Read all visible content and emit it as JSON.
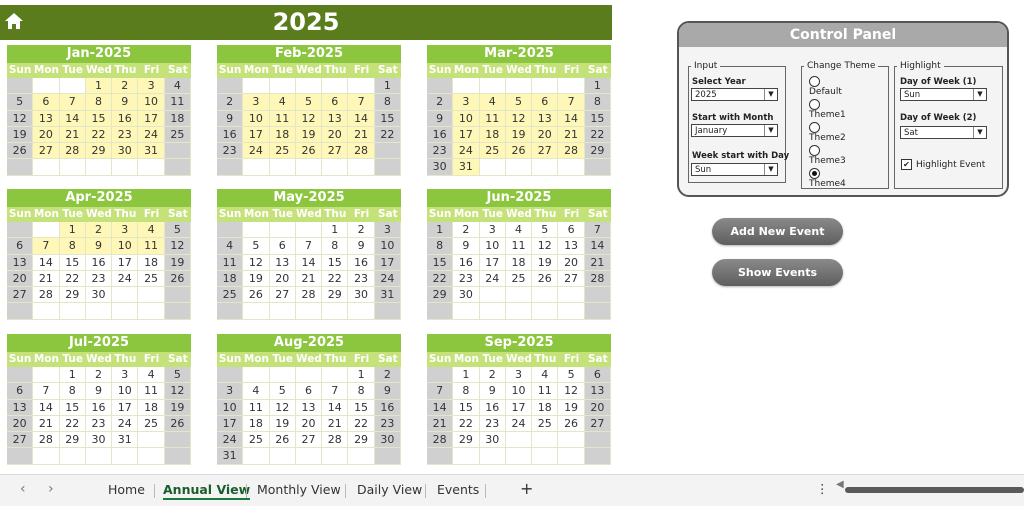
{
  "header": {
    "year_title": "2025"
  },
  "day_names": [
    "Sun",
    "Mon",
    "Tue",
    "Wed",
    "Thu",
    "Fri",
    "Sat"
  ],
  "months": [
    {
      "title": "Jan-2025",
      "start": 3,
      "days": 31
    },
    {
      "title": "Feb-2025",
      "start": 6,
      "days": 28
    },
    {
      "title": "Mar-2025",
      "start": 6,
      "days": 31
    },
    {
      "title": "Apr-2025",
      "start": 2,
      "days": 30
    },
    {
      "title": "May-2025",
      "start": 4,
      "days": 31
    },
    {
      "title": "Jun-2025",
      "start": 0,
      "days": 30
    },
    {
      "title": "Jul-2025",
      "start": 2,
      "days": 31
    },
    {
      "title": "Aug-2025",
      "start": 5,
      "days": 31
    },
    {
      "title": "Sep-2025",
      "start": 1,
      "days": 30
    }
  ],
  "control_panel": {
    "title": "Control Panel",
    "input": {
      "legend": "Input",
      "select_year_label": "Select Year",
      "select_year_value": "2025",
      "start_month_label": "Start with Month",
      "start_month_value": "January",
      "week_start_label": "Week start with Day",
      "week_start_value": "Sun"
    },
    "theme": {
      "legend": "Change Theme",
      "options": [
        "Default",
        "Theme1",
        "Theme2",
        "Theme3",
        "Theme4"
      ],
      "selected": "Theme4"
    },
    "highlight": {
      "legend": "Highlight",
      "dow1_label": "Day of Week (1)",
      "dow1_value": "Sun",
      "dow2_label": "Day of Week (2)",
      "dow2_value": "Sat",
      "event_label": "Highlight Event",
      "event_checked": true
    }
  },
  "buttons": {
    "add_event": "Add New Event",
    "show_events": "Show Events"
  },
  "sheet_tabs": [
    "Home",
    "Annual View",
    "Monthly View",
    "Daily View",
    "Events"
  ],
  "active_tab": "Annual View",
  "add_sheet": "+",
  "more_icon": "⋮",
  "colors": {
    "header": "#5a7c1c",
    "month_title": "#8cc63f",
    "day_header": "#c5e17a",
    "weekend": "#d0d0d0"
  }
}
